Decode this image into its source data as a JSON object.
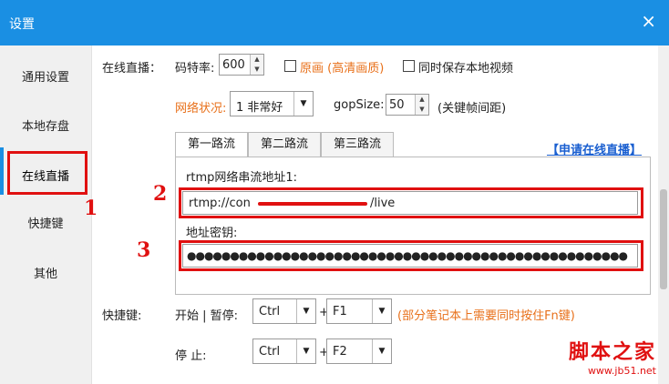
{
  "window": {
    "title": "设置",
    "close_icon": "×"
  },
  "sidebar": {
    "items": [
      {
        "label": "通用设置"
      },
      {
        "label": "本地存盘"
      },
      {
        "label": "在线直播"
      },
      {
        "label": "快捷键"
      },
      {
        "label": "其他"
      }
    ],
    "active_index": 2
  },
  "annotations": {
    "n1": "1",
    "n2": "2",
    "n3": "3"
  },
  "live": {
    "section_label": "在线直播：",
    "bitrate_label": "码特率:",
    "bitrate_value": "600",
    "original_label": "原画 (高清画质)",
    "save_local_label": "同时保存本地视频",
    "network_label": "网络状况:",
    "network_value": "1 非常好",
    "gop_label": "gopSize:",
    "gop_value": "50",
    "gop_hint": "(关键帧间距)",
    "tabs": [
      "第一路流",
      "第二路流",
      "第三路流"
    ],
    "apply_link": "【申请在线直播】",
    "rtmp_label": "rtmp网络串流地址1:",
    "rtmp_value": "rtmp://con",
    "rtmp_suffix": "/live",
    "key_label": "地址密钥:",
    "key_value": "●●●●●●●●●●●●●●●●●●●●●●●●●●●●●●●●●●●●●●●●●●●●●●●●●●●"
  },
  "hotkeys": {
    "section_label": "快捷键:",
    "start_label": "开始 | 暂停:",
    "start_mod": "Ctrl",
    "start_key": "F1",
    "hint": "(部分笔记本上需要同时按住Fn键)",
    "stop_label": "停    止:",
    "stop_mod": "Ctrl",
    "stop_key": "F2",
    "plus": "+"
  },
  "watermark": {
    "cn": "脚本之家",
    "url": "www.jb51.net"
  },
  "colors": {
    "titlebar": "#1a8fe3",
    "annotation": "#e01010",
    "orange": "#e8701a",
    "link": "#1a5fd0"
  }
}
